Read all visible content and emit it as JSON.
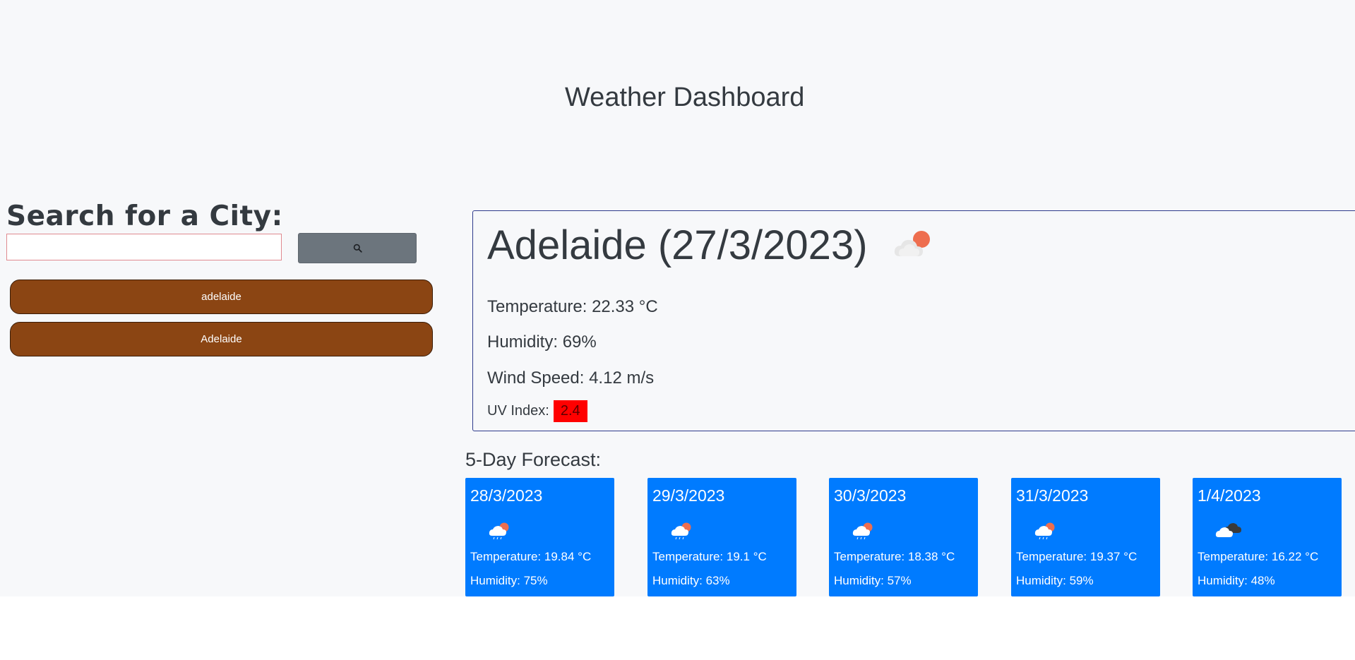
{
  "header": {
    "title": "Weather Dashboard"
  },
  "search": {
    "heading": "Search for a City:",
    "input_value": "",
    "placeholder": "",
    "button_icon": "search-icon"
  },
  "history": [
    {
      "label": "adelaide"
    },
    {
      "label": "Adelaide"
    }
  ],
  "current": {
    "city_heading": "Adelaide (27/3/2023)",
    "icon": "partly-cloudy-day-icon",
    "temperature": "Temperature: 22.33 °C",
    "humidity": "Humidity: 69%",
    "wind": "Wind Speed: 4.12 m/s",
    "uv_label": "UV Index:",
    "uv_value": "2.4",
    "uv_color": "#ff0000"
  },
  "forecast": {
    "heading": "5-Day Forecast:",
    "card_color": "#007bff",
    "days": [
      {
        "date": "28/3/2023",
        "icon": "light-rain-day-icon",
        "temperature": "Temperature: 19.84 °C",
        "humidity": "Humidity: 75%"
      },
      {
        "date": "29/3/2023",
        "icon": "light-rain-day-icon",
        "temperature": "Temperature: 19.1 °C",
        "humidity": "Humidity: 63%"
      },
      {
        "date": "30/3/2023",
        "icon": "light-rain-day-icon",
        "temperature": "Temperature: 18.38 °C",
        "humidity": "Humidity: 57%"
      },
      {
        "date": "31/3/2023",
        "icon": "light-rain-day-icon",
        "temperature": "Temperature: 19.37 °C",
        "humidity": "Humidity: 59%"
      },
      {
        "date": "1/4/2023",
        "icon": "broken-clouds-icon",
        "temperature": "Temperature: 16.22 °C",
        "humidity": "Humidity: 48%"
      }
    ]
  },
  "colors": {
    "page_background": "#f7f8fa",
    "history_button": "#8b4513",
    "search_button": "#6c757d",
    "card_border": "#2e3a8c"
  }
}
